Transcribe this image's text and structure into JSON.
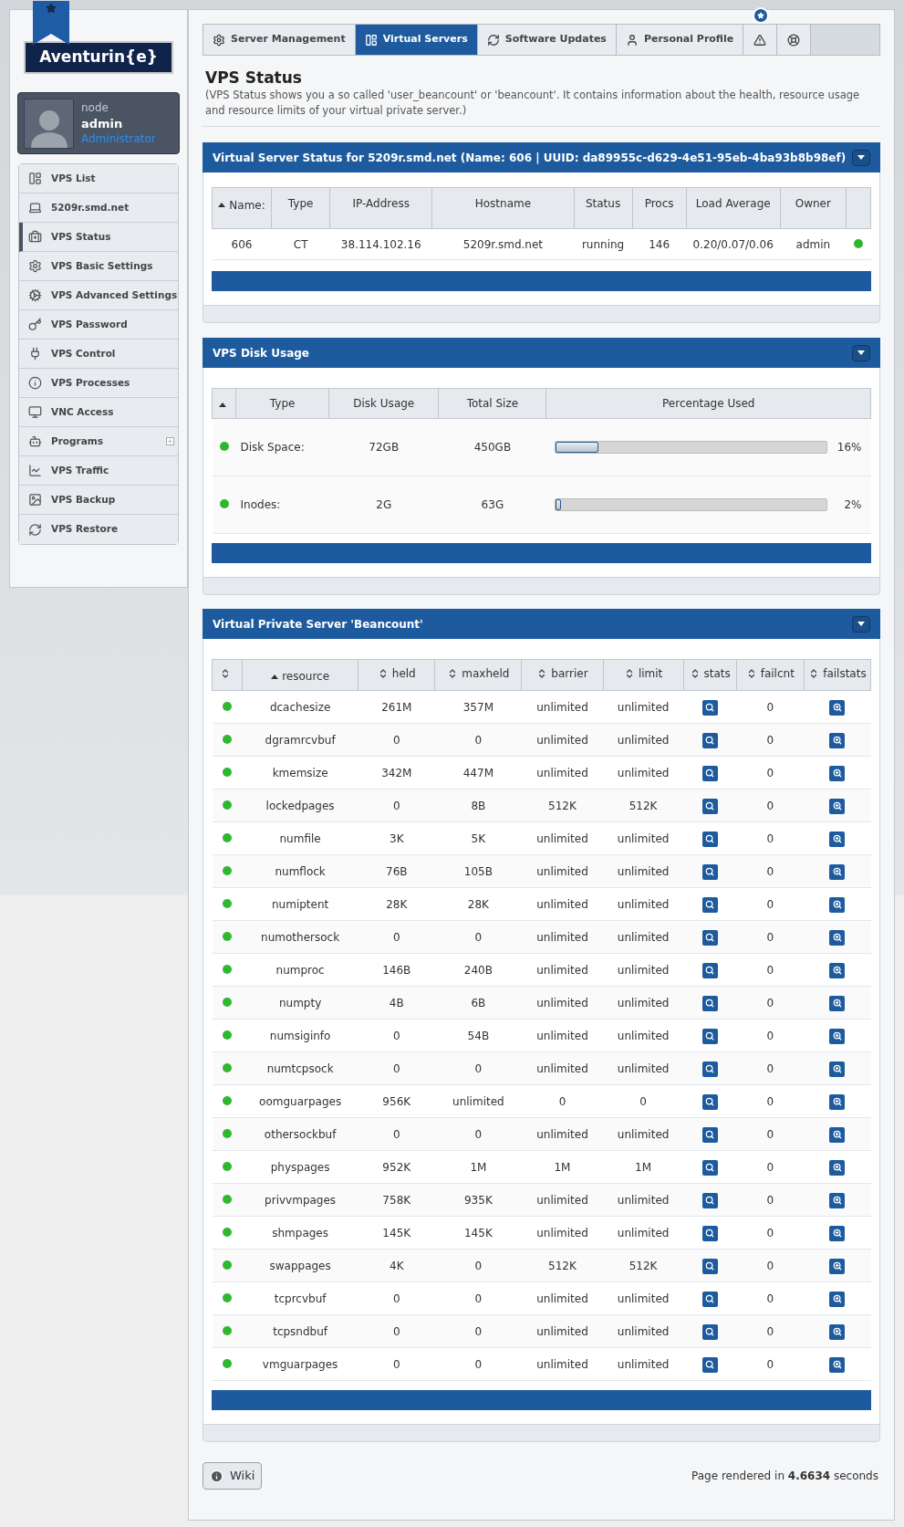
{
  "logo": {
    "text": "Aventurin{e}"
  },
  "user": {
    "node": "node",
    "name": "admin",
    "role": "Administrator"
  },
  "sidebar": {
    "items": [
      {
        "label": "VPS List",
        "selected": false,
        "expandable": false
      },
      {
        "label": "5209r.smd.net",
        "selected": false,
        "expandable": false
      },
      {
        "label": "VPS Status",
        "selected": true,
        "expandable": false
      },
      {
        "label": "VPS Basic Settings",
        "selected": false,
        "expandable": false
      },
      {
        "label": "VPS Advanced Settings",
        "selected": false,
        "expandable": false
      },
      {
        "label": "VPS Password",
        "selected": false,
        "expandable": false
      },
      {
        "label": "VPS Control",
        "selected": false,
        "expandable": false
      },
      {
        "label": "VPS Processes",
        "selected": false,
        "expandable": false
      },
      {
        "label": "VNC Access",
        "selected": false,
        "expandable": false
      },
      {
        "label": "Programs",
        "selected": false,
        "expandable": true
      },
      {
        "label": "VPS Traffic",
        "selected": false,
        "expandable": false
      },
      {
        "label": "VPS Backup",
        "selected": false,
        "expandable": false
      },
      {
        "label": "VPS Restore",
        "selected": false,
        "expandable": false
      }
    ]
  },
  "tabs": [
    {
      "kind": "text",
      "label": "Server Management",
      "selected": false
    },
    {
      "kind": "text",
      "label": "Virtual Servers",
      "selected": true
    },
    {
      "kind": "text",
      "label": "Software Updates",
      "selected": false
    },
    {
      "kind": "text",
      "label": "Personal Profile",
      "selected": false
    },
    {
      "kind": "icon",
      "selected": false,
      "badge": true
    },
    {
      "kind": "icon",
      "selected": false
    }
  ],
  "page": {
    "title": "VPS Status",
    "description": "(VPS Status shows you a so called 'user_beancount' or 'beancount'. It contains information about the health, resource usage and resource limits of your virtual private server.)"
  },
  "status_panel": {
    "title": "Virtual Server Status for 5209r.smd.net (Name: 606 | UUID: da89955c-d629-4e51-95eb-4ba93b8b98ef)",
    "sortable_icons": false,
    "columns": [
      {
        "label": "Name:",
        "sorted": true
      },
      {
        "label": "Type",
        "sorted": false
      },
      {
        "label": "IP-Address",
        "sorted": false
      },
      {
        "label": "Hostname",
        "sorted": false
      },
      {
        "label": "Status",
        "sorted": false
      },
      {
        "label": "Procs",
        "sorted": false
      },
      {
        "label": "Load Average",
        "sorted": false
      },
      {
        "label": "Owner",
        "sorted": false
      },
      {
        "sorted": false
      }
    ],
    "rows": [
      {
        "cells": [
          "606",
          "CT",
          "38.114.102.16",
          "5209r.smd.net",
          "running",
          "146",
          "0.20/0.07/0.06",
          "admin"
        ],
        "healthy": true
      }
    ]
  },
  "disk_panel": {
    "title": "VPS Disk Usage",
    "sortable_icons": false,
    "columns": [
      {
        "sorted": true
      },
      {
        "label": "Type",
        "sorted": false
      },
      {
        "label": "Disk Usage",
        "sorted": false
      },
      {
        "label": "Total Size",
        "sorted": false
      },
      {
        "label": "Percentage Used",
        "sorted": false
      }
    ],
    "rows": [
      {
        "healthy": true,
        "type": "Disk Space:",
        "usage": "72GB",
        "total": "450GB",
        "level": 0.16,
        "percent": "16%"
      },
      {
        "healthy": true,
        "type": "Inodes:",
        "usage": "2G",
        "total": "63G",
        "level": 0.02,
        "percent": "2%"
      }
    ]
  },
  "beancount_panel": {
    "title": "Virtual Private Server 'Beancount'",
    "sortable_icons": true,
    "columns": [
      {
        "sorted": false
      },
      {
        "label": "resource",
        "sorted": true
      },
      {
        "label": "held",
        "sorted": false
      },
      {
        "label": "maxheld",
        "sorted": false
      },
      {
        "label": "barrier",
        "sorted": false
      },
      {
        "label": "limit",
        "sorted": false
      },
      {
        "label": "stats",
        "sorted": false
      },
      {
        "label": "failcnt",
        "sorted": false
      },
      {
        "label": "failstats",
        "sorted": false
      }
    ],
    "rows": [
      {
        "healthy": true,
        "resource": "dcachesize",
        "held": "261M",
        "maxheld": "357M",
        "barrier": "unlimited",
        "limit": "unlimited",
        "failcnt": "0"
      },
      {
        "healthy": true,
        "resource": "dgramrcvbuf",
        "held": "0",
        "maxheld": "0",
        "barrier": "unlimited",
        "limit": "unlimited",
        "failcnt": "0"
      },
      {
        "healthy": true,
        "resource": "kmemsize",
        "held": "342M",
        "maxheld": "447M",
        "barrier": "unlimited",
        "limit": "unlimited",
        "failcnt": "0"
      },
      {
        "healthy": true,
        "resource": "lockedpages",
        "held": "0",
        "maxheld": "8B",
        "barrier": "512K",
        "limit": "512K",
        "failcnt": "0"
      },
      {
        "healthy": true,
        "resource": "numfile",
        "held": "3K",
        "maxheld": "5K",
        "barrier": "unlimited",
        "limit": "unlimited",
        "failcnt": "0"
      },
      {
        "healthy": true,
        "resource": "numflock",
        "held": "76B",
        "maxheld": "105B",
        "barrier": "unlimited",
        "limit": "unlimited",
        "failcnt": "0"
      },
      {
        "healthy": true,
        "resource": "numiptent",
        "held": "28K",
        "maxheld": "28K",
        "barrier": "unlimited",
        "limit": "unlimited",
        "failcnt": "0"
      },
      {
        "healthy": true,
        "resource": "numothersock",
        "held": "0",
        "maxheld": "0",
        "barrier": "unlimited",
        "limit": "unlimited",
        "failcnt": "0"
      },
      {
        "healthy": true,
        "resource": "numproc",
        "held": "146B",
        "maxheld": "240B",
        "barrier": "unlimited",
        "limit": "unlimited",
        "failcnt": "0"
      },
      {
        "healthy": true,
        "resource": "numpty",
        "held": "4B",
        "maxheld": "6B",
        "barrier": "unlimited",
        "limit": "unlimited",
        "failcnt": "0"
      },
      {
        "healthy": true,
        "resource": "numsiginfo",
        "held": "0",
        "maxheld": "54B",
        "barrier": "unlimited",
        "limit": "unlimited",
        "failcnt": "0"
      },
      {
        "healthy": true,
        "resource": "numtcpsock",
        "held": "0",
        "maxheld": "0",
        "barrier": "unlimited",
        "limit": "unlimited",
        "failcnt": "0"
      },
      {
        "healthy": true,
        "resource": "oomguarpages",
        "held": "956K",
        "maxheld": "unlimited",
        "barrier": "0",
        "limit": "0",
        "failcnt": "0"
      },
      {
        "healthy": true,
        "resource": "othersockbuf",
        "held": "0",
        "maxheld": "0",
        "barrier": "unlimited",
        "limit": "unlimited",
        "failcnt": "0"
      },
      {
        "healthy": true,
        "resource": "physpages",
        "held": "952K",
        "maxheld": "1M",
        "barrier": "1M",
        "limit": "1M",
        "failcnt": "0"
      },
      {
        "healthy": true,
        "resource": "privvmpages",
        "held": "758K",
        "maxheld": "935K",
        "barrier": "unlimited",
        "limit": "unlimited",
        "failcnt": "0"
      },
      {
        "healthy": true,
        "resource": "shmpages",
        "held": "145K",
        "maxheld": "145K",
        "barrier": "unlimited",
        "limit": "unlimited",
        "failcnt": "0"
      },
      {
        "healthy": true,
        "resource": "swappages",
        "held": "4K",
        "maxheld": "0",
        "barrier": "512K",
        "limit": "512K",
        "failcnt": "0"
      },
      {
        "healthy": true,
        "resource": "tcprcvbuf",
        "held": "0",
        "maxheld": "0",
        "barrier": "unlimited",
        "limit": "unlimited",
        "failcnt": "0"
      },
      {
        "healthy": true,
        "resource": "tcpsndbuf",
        "held": "0",
        "maxheld": "0",
        "barrier": "unlimited",
        "limit": "unlimited",
        "failcnt": "0"
      },
      {
        "healthy": true,
        "resource": "vmguarpages",
        "held": "0",
        "maxheld": "0",
        "barrier": "unlimited",
        "limit": "unlimited",
        "failcnt": "0"
      }
    ]
  },
  "footer": {
    "wiki": "Wiki",
    "rendered": "Page rendered in **4.6634** seconds"
  }
}
